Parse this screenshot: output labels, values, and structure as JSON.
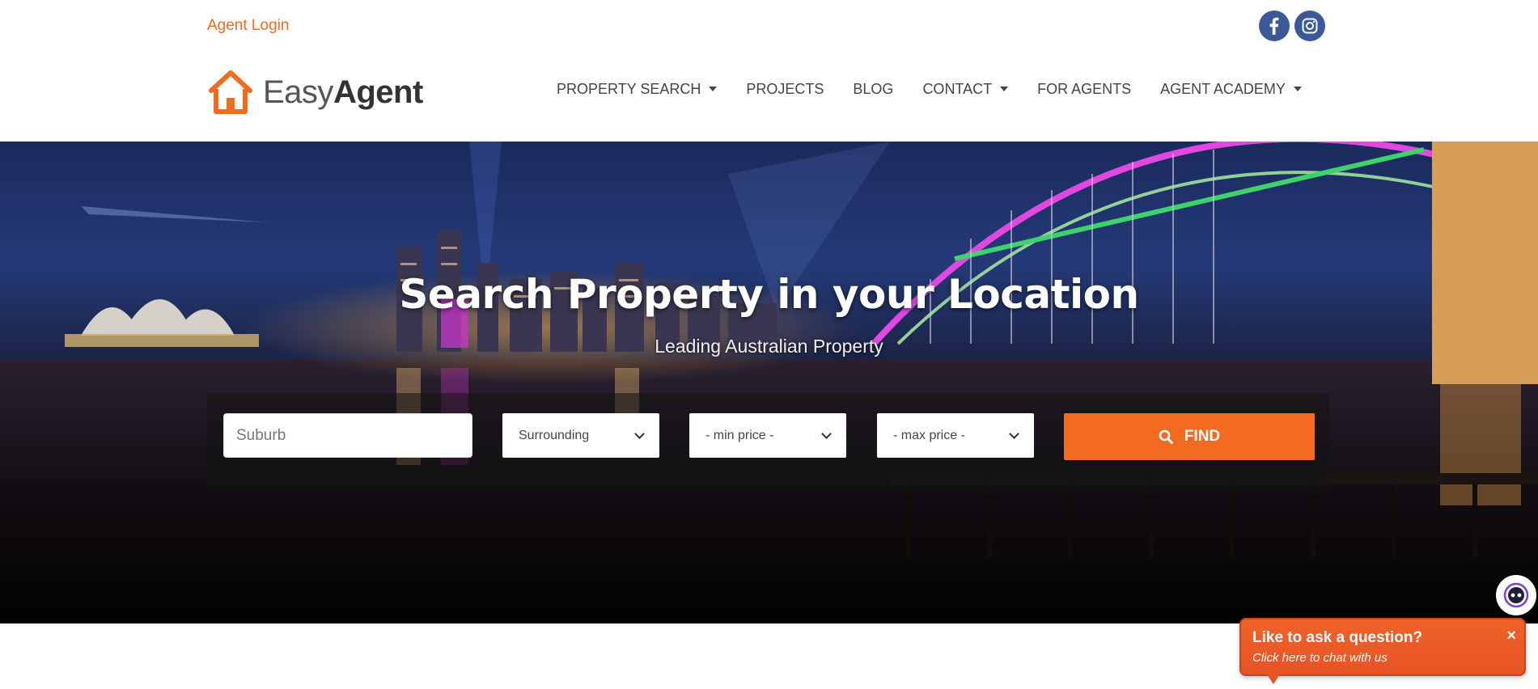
{
  "topbar": {
    "agent_login": "Agent Login",
    "social": [
      {
        "name": "facebook-icon"
      },
      {
        "name": "instagram-icon"
      }
    ]
  },
  "logo": {
    "text_light": "Easy",
    "text_bold": "Agent"
  },
  "nav": {
    "items": [
      {
        "label": "PROPERTY SEARCH",
        "dropdown": true
      },
      {
        "label": "PROJECTS",
        "dropdown": false
      },
      {
        "label": "BLOG",
        "dropdown": false
      },
      {
        "label": "CONTACT",
        "dropdown": true
      },
      {
        "label": "FOR AGENTS",
        "dropdown": false
      },
      {
        "label": "AGENT ACADEMY",
        "dropdown": true
      }
    ]
  },
  "hero": {
    "title": "Search Property in your Location",
    "subtitle": "Leading Australian Property"
  },
  "search": {
    "suburb_placeholder": "Suburb",
    "surrounding": "Surrounding",
    "min_price": "- min price -",
    "max_price": "- max price -",
    "find_label": "FIND"
  },
  "chat": {
    "title": "Like to ask a question?",
    "subtitle": "Click here to chat with us",
    "close": "×"
  },
  "colors": {
    "accent": "#f26b21",
    "facebook": "#3b5998"
  }
}
